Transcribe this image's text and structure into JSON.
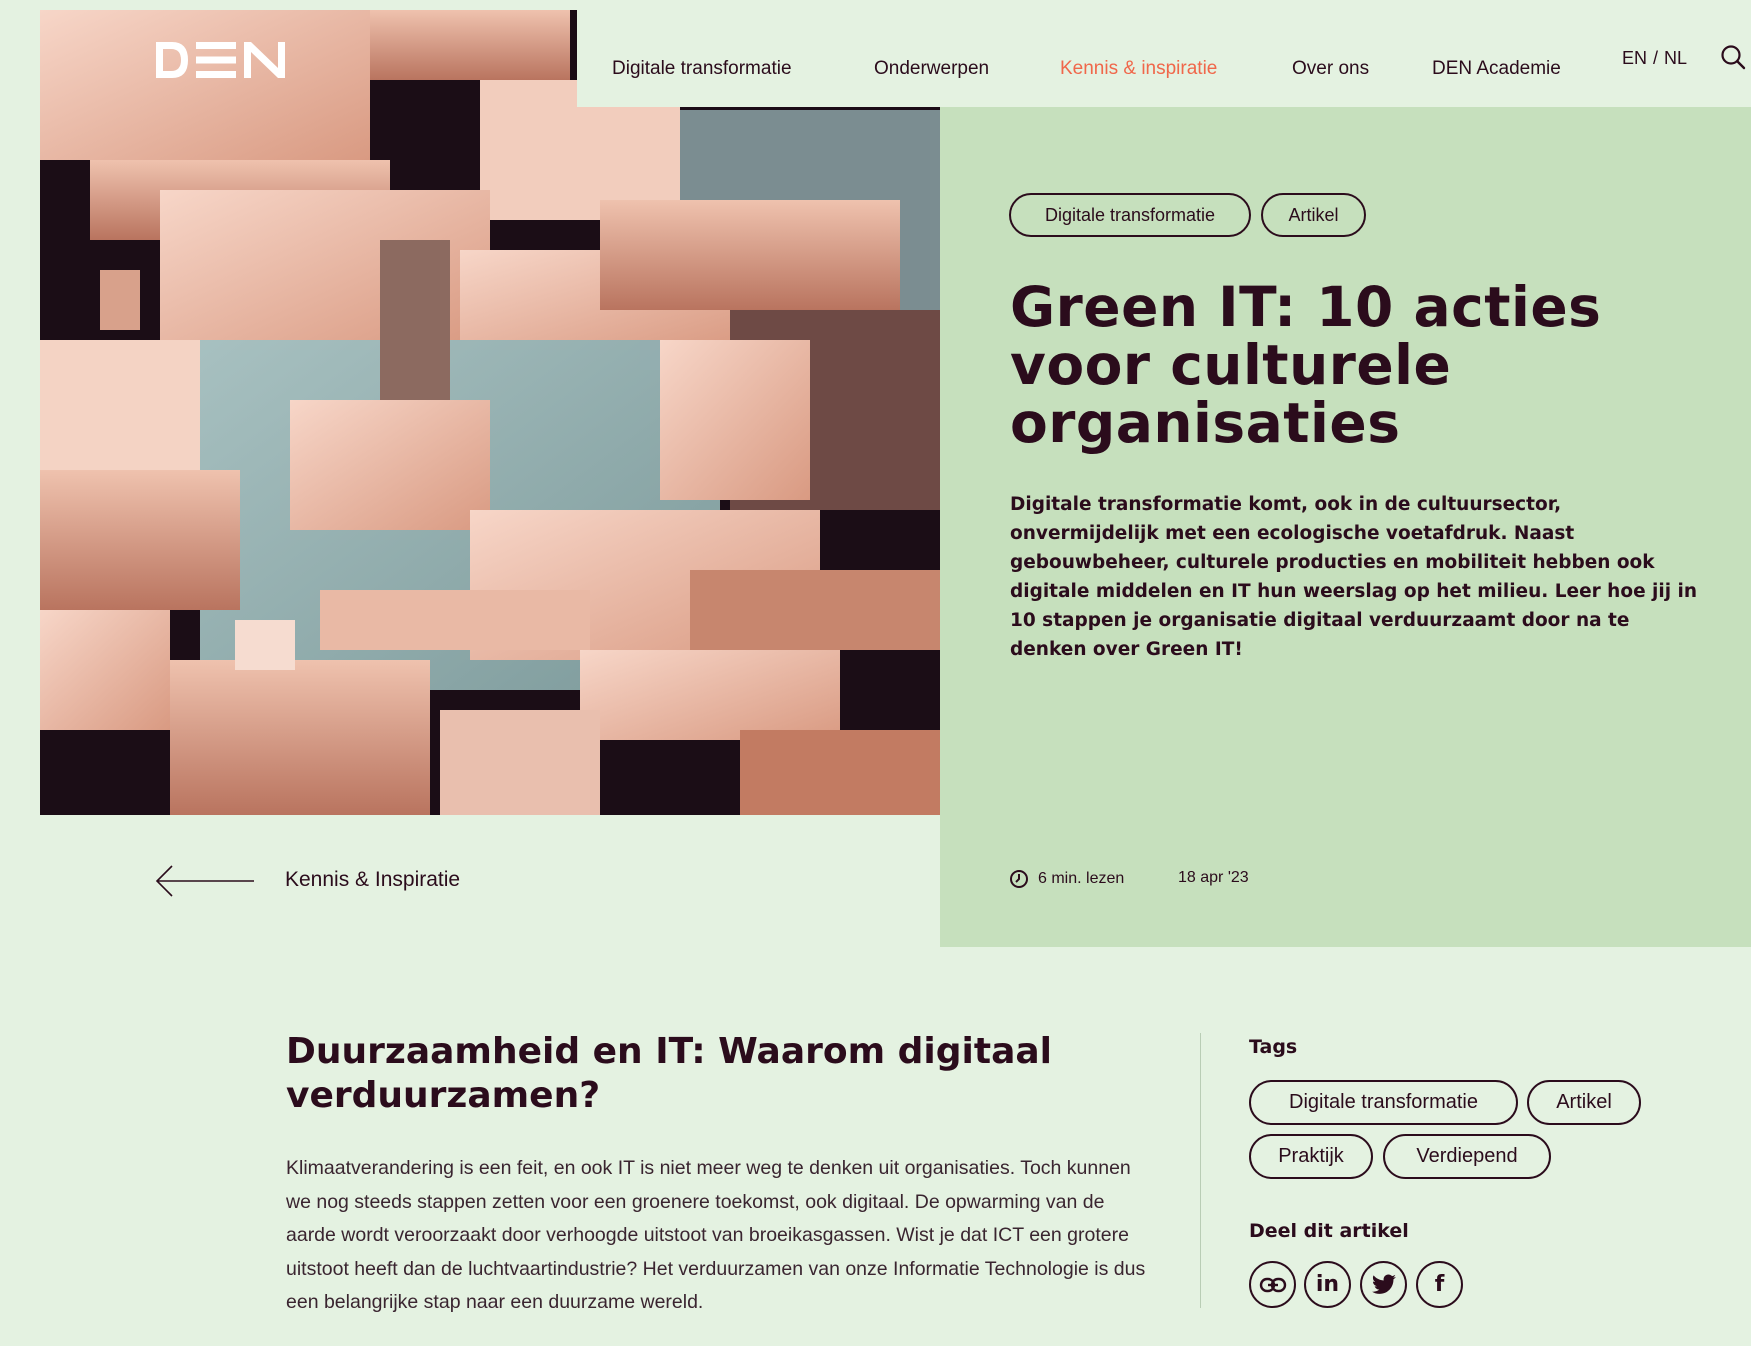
{
  "brand": {
    "logo_text": "DEN"
  },
  "nav": {
    "items": [
      {
        "label": "Digitale transformatie"
      },
      {
        "label": "Onderwerpen"
      },
      {
        "label": "Kennis & inspiratie"
      },
      {
        "label": "Over ons"
      },
      {
        "label": "DEN Academie"
      }
    ],
    "active_index": 2,
    "lang": {
      "en": "EN",
      "separator": "/",
      "nl": "NL"
    },
    "search_icon": "search-icon"
  },
  "hero": {
    "pills": [
      "Digitale transformatie",
      "Artikel"
    ],
    "title": "Green IT: 10 acties voor culturele organisaties",
    "lead": "Digitale transformatie komt, ook in de cultuursector, onvermijdelijk met een ecologische voetafdruk. Naast gebouwbeheer, culturele producties en mobiliteit hebben ook digitale middelen en IT hun weerslag op het milieu. Leer hoe jij in 10 stappen je organisatie digitaal verduurzaamt door na te denken over Green IT!",
    "read_time": "6 min. lezen",
    "date": "18 apr '23"
  },
  "back_link": {
    "label": "Kennis & Inspiratie"
  },
  "article": {
    "heading": "Duurzaamheid en IT: Waarom digitaal verduurzamen?",
    "body": "Klimaatverandering is een feit, en ook IT is niet meer weg te denken uit organisaties. Toch kunnen we nog steeds stappen zetten voor een groenere toekomst, ook digitaal. De opwarming van de aarde wordt veroorzaakt door verhoogde uitstoot van broeikasgassen. Wist je dat ICT een grotere uitstoot heeft dan de luchtvaartindustrie? Het verduurzamen van onze Informatie Technologie is dus een belangrijke stap naar een duurzame wereld."
  },
  "sidebar": {
    "tags_heading": "Tags",
    "tags": [
      "Digitale transformatie",
      "Artikel",
      "Praktijk",
      "Verdiepend"
    ],
    "share_heading": "Deel dit artikel",
    "share": [
      {
        "icon": "link-icon"
      },
      {
        "icon": "linkedin-icon",
        "text": "in"
      },
      {
        "icon": "twitter-icon"
      },
      {
        "icon": "facebook-icon",
        "text": "f"
      }
    ]
  },
  "colors": {
    "background": "#e4f2e1",
    "panel": "#c6e0bd",
    "text": "#2b0c1c",
    "accent": "#f0674a"
  }
}
